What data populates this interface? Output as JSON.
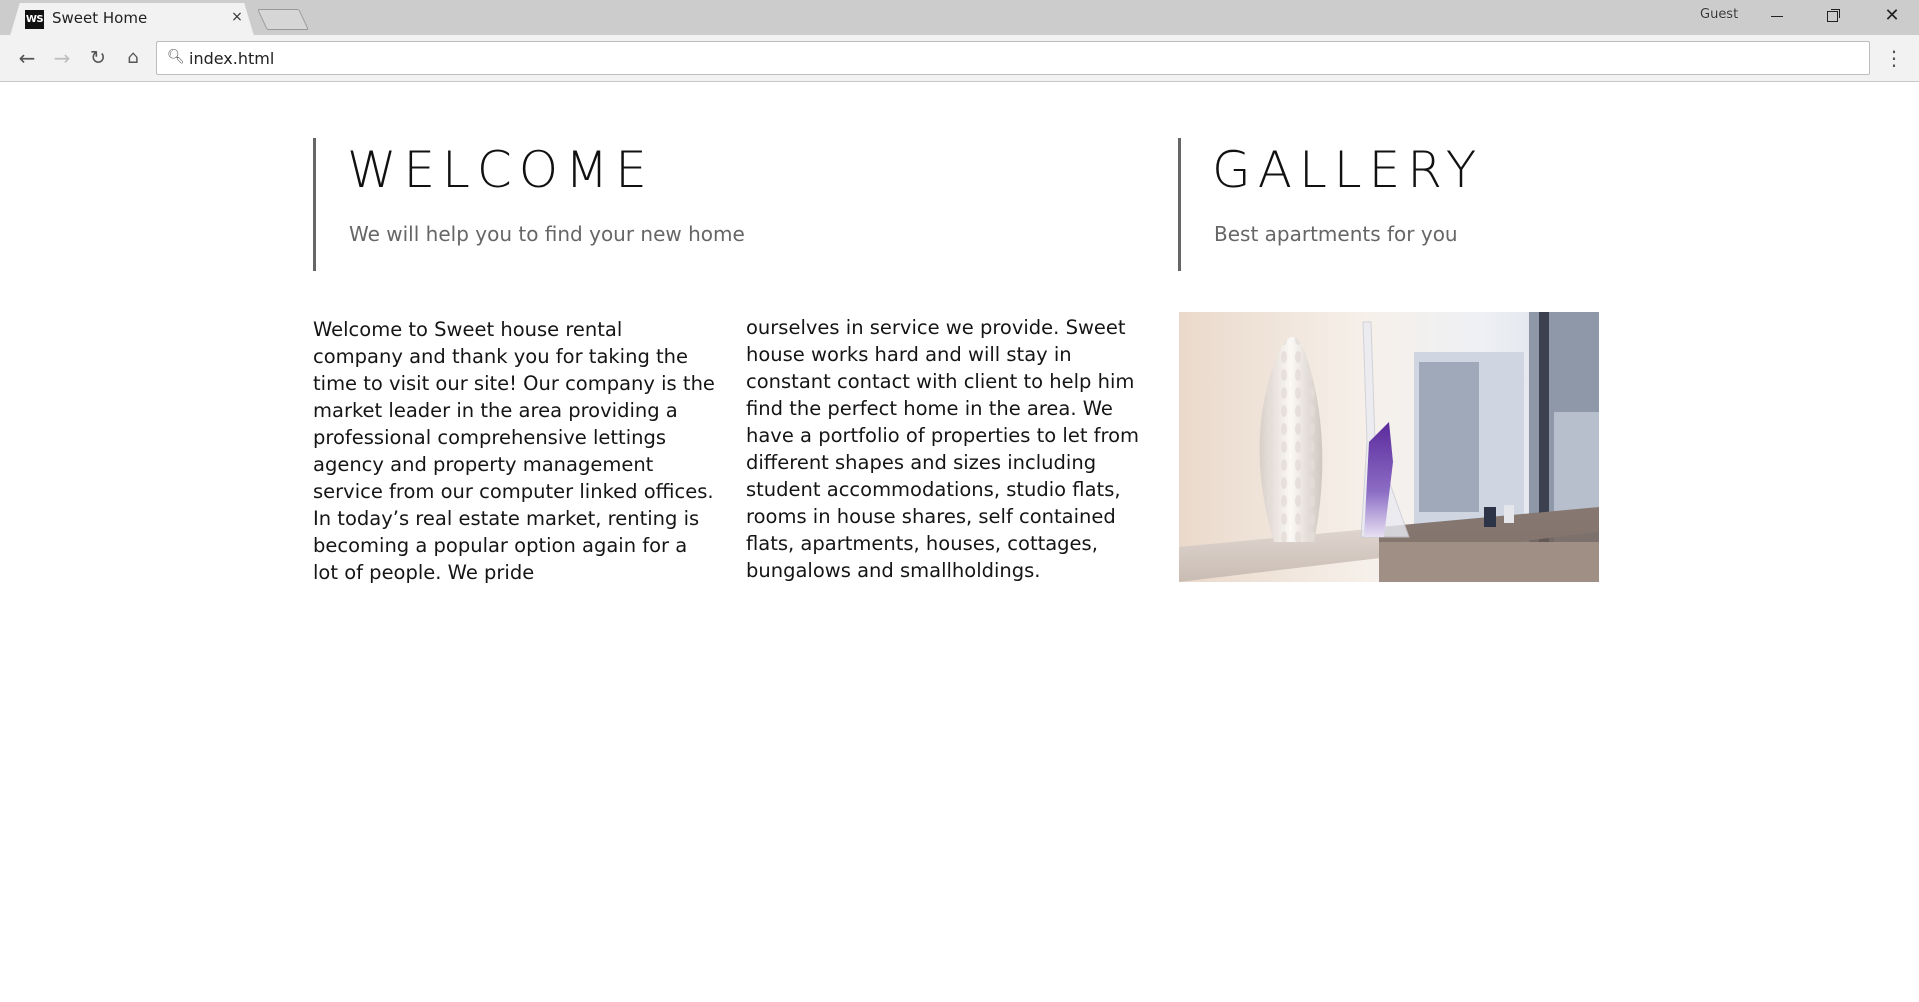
{
  "browser": {
    "tab_title": "Sweet Home",
    "tab_favicon_text": "WS",
    "tab_close_icon": "×",
    "profile_label": "Guest",
    "address": "index.html",
    "icons": {
      "back": "back-arrow-icon",
      "forward": "forward-arrow-icon",
      "reload": "reload-icon",
      "home": "home-icon",
      "search": "search-icon",
      "menu": "kebab-menu-icon"
    }
  },
  "page": {
    "welcome": {
      "title": "WELCOME",
      "subtitle": "We will help you to find your new home"
    },
    "gallery": {
      "title": "GALLERY",
      "subtitle": "Best apartments for you"
    },
    "paragraph_col1": "Welcome to Sweet house rental company and thank you for taking the time to visit our site! Our company is the market leader in the area providing a professional comprehensive lettings agency and property management service from our computer linked offices. In today’s real estate market, renting is becoming a popular option again for a lot of people. We pride",
    "paragraph_col2": "ourselves in service we provide. Sweet house works hard and will stay in constant contact with client to help him find the perfect home in the area. We have a portfolio of properties to let from different shapes and sizes including student accommodations, studio flats, rooms in house shares, self contained flats, apartments, houses, cottages, bungalows and smallholdings."
  },
  "colors": {
    "accent_border": "#666666",
    "tabbar_bg": "#cccccc",
    "toolbar_bg": "#f2f2f2"
  }
}
